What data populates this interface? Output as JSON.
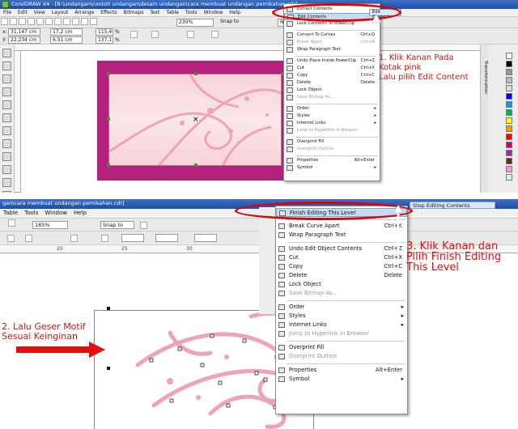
{
  "panel1": {
    "title": "CorelDRAW X4 - [B:\\undangan\\contoh undangan\\desain undangan\\cara membuat undangan pernikahan.cdr]",
    "menus": [
      "File",
      "Edit",
      "View",
      "Layout",
      "Arrange",
      "Effects",
      "Bitmaps",
      "Text",
      "Table",
      "Tools",
      "Window",
      "Help"
    ],
    "x": "31,147 cm",
    "y": "22,234 cm",
    "w": "17,2 cm",
    "h": "6,51 cm",
    "sx": "115,4",
    "sy": "137,1",
    "pct": "%",
    "zoom": "230%",
    "snap": "Snap to",
    "no_label": "No",
    "edit_contents_tag": "Edit Contents",
    "context_menu": [
      {
        "label": "Extract Contents"
      },
      {
        "label": "Edit Contents",
        "highlight": true
      },
      {
        "label": "Lock Contents To PowerClip"
      },
      {
        "sep": true
      },
      {
        "label": "Convert To Curves",
        "shortcut": "Ctrl+Q"
      },
      {
        "label": "Break Apart",
        "shortcut": "Ctrl+K",
        "disabled": true
      },
      {
        "label": "Wrap Paragraph Text"
      },
      {
        "sep": true
      },
      {
        "label": "Undo Place Inside PowerClip",
        "shortcut": "Ctrl+Z"
      },
      {
        "label": "Cut",
        "shortcut": "Ctrl+X"
      },
      {
        "label": "Copy",
        "shortcut": "Ctrl+C"
      },
      {
        "label": "Delete",
        "shortcut": "Delete"
      },
      {
        "label": "Lock Object"
      },
      {
        "label": "Save Bitmap As...",
        "disabled": true
      },
      {
        "sep": true
      },
      {
        "label": "Order",
        "sub": true
      },
      {
        "label": "Styles",
        "sub": true
      },
      {
        "label": "Internet Links",
        "sub": true
      },
      {
        "label": "Jump to Hyperlink in Browser",
        "disabled": true
      },
      {
        "sep": true
      },
      {
        "label": "Overprint Fill"
      },
      {
        "label": "Overprint Outline",
        "disabled": true
      },
      {
        "sep": true
      },
      {
        "label": "Properties",
        "shortcut": "Alt+Enter"
      },
      {
        "label": "Symbol",
        "sub": true
      }
    ],
    "docker_label": "Transformation",
    "annotation": [
      "1. Klik Kanan Pada",
      "Kotak pink",
      "Lalu pilih Edit Content"
    ],
    "palette": [
      "#ffffff",
      "#000000",
      "#999999",
      "#bbbbbb",
      "#dddddd",
      "#0000ff",
      "#00a0e0",
      "#00b050",
      "#ffff00",
      "#ff9900",
      "#ff0000",
      "#cc0066",
      "#993399",
      "#663300",
      "#ff99cc",
      "#ccffcc"
    ]
  },
  "panel2": {
    "title_fragment": "gan\\cara membuat undangan pernikahan.cdr]",
    "menus": [
      "Table",
      "Tools",
      "Window",
      "Help"
    ],
    "zoom": "185%",
    "snap": "Snap to",
    "ruler_marks": [
      "20",
      "25",
      "30"
    ],
    "stop_editing": "Stop Editing Contents",
    "context_menu": [
      {
        "label": "Finish Editing This Level",
        "highlight": true
      },
      {
        "sep": true
      },
      {
        "label": "Break Curve Apart",
        "shortcut": "Ctrl+K"
      },
      {
        "label": "Wrap Paragraph Text"
      },
      {
        "sep": true
      },
      {
        "label": "Undo Edit Object Contents",
        "shortcut": "Ctrl+Z"
      },
      {
        "label": "Cut",
        "shortcut": "Ctrl+X"
      },
      {
        "label": "Copy",
        "shortcut": "Ctrl+C"
      },
      {
        "label": "Delete",
        "shortcut": "Delete"
      },
      {
        "label": "Lock Object"
      },
      {
        "label": "Save Bitmap As...",
        "disabled": true
      },
      {
        "sep": true
      },
      {
        "label": "Order",
        "sub": true
      },
      {
        "label": "Styles",
        "sub": true
      },
      {
        "label": "Internet Links",
        "sub": true
      },
      {
        "label": "Jump to Hyperlink in Browser",
        "disabled": true
      },
      {
        "sep": true
      },
      {
        "label": "Overprint Fill"
      },
      {
        "label": "Overprint Outline",
        "disabled": true
      },
      {
        "sep": true
      },
      {
        "label": "Properties",
        "shortcut": "Alt+Enter"
      },
      {
        "label": "Symbol",
        "sub": true
      }
    ],
    "annotation_right": [
      "3. Klik Kanan dan",
      "Pilih Finish Editing",
      "This Level"
    ],
    "annotation_left": [
      "2. Lalu Geser Motif",
      "Sesuai Keinginan"
    ]
  },
  "colors": {
    "accent_red": "#e01010",
    "frame_magenta": "#b3207d",
    "pink_light": "#f8d7dc",
    "swirl": "#eea4b6",
    "menu_highlight": "#c7dcf3"
  }
}
